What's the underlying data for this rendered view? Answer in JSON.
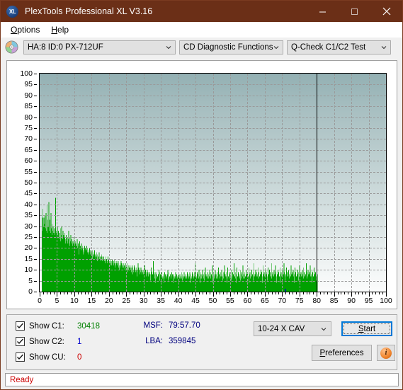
{
  "window": {
    "title": "PlexTools Professional XL V3.16",
    "icon": "xl-logo-icon",
    "minimize": "—",
    "maximize": "☐",
    "close": "✕"
  },
  "menubar": {
    "items": [
      {
        "label": "Options",
        "accel": "O"
      },
      {
        "label": "Help",
        "accel": "H"
      }
    ]
  },
  "toolbar": {
    "disc_icon": "cd-disc-icon",
    "drive_select": "HA:8 ID:0  PX-712UF",
    "function_select": "CD Diagnostic Functions",
    "test_select": "Q-Check C1/C2 Test"
  },
  "controls": {
    "checkboxes": [
      {
        "label": "Show C1:",
        "value": "30418",
        "checked": true,
        "color": "#008000"
      },
      {
        "label": "Show C2:",
        "value": "1",
        "checked": true,
        "color": "#0000cc"
      },
      {
        "label": "Show CU:",
        "value": "0",
        "checked": true,
        "color": "#cc0000"
      }
    ],
    "readouts": [
      {
        "key": "MSF:",
        "value": "79:57.70"
      },
      {
        "key": "LBA:",
        "value": "359845"
      }
    ],
    "speed_select": "10-24 X CAV",
    "start_button": "Start",
    "preferences_button": "Preferences",
    "info_button": "i"
  },
  "status": {
    "text": "Ready"
  },
  "chart_data": {
    "type": "bar",
    "title": "",
    "xlabel": "",
    "ylabel": "",
    "xlim": [
      0,
      100
    ],
    "ylim": [
      0,
      100
    ],
    "xticks": [
      0,
      5,
      10,
      15,
      20,
      25,
      30,
      35,
      40,
      45,
      50,
      55,
      60,
      65,
      70,
      75,
      80,
      85,
      90,
      95,
      100
    ],
    "yticks": [
      0,
      5,
      10,
      15,
      20,
      25,
      30,
      35,
      40,
      45,
      50,
      55,
      60,
      65,
      70,
      75,
      80,
      85,
      90,
      95,
      100
    ],
    "grid": true,
    "legend": false,
    "data_end_x": 80,
    "end_marker_x": 80,
    "series": [
      {
        "name": "C1",
        "color": "#00a000",
        "x_start": 0.6,
        "x_end": 80.2,
        "values": [
          28,
          34,
          31,
          38,
          30,
          26,
          34,
          27,
          31,
          35,
          24,
          29,
          36,
          28,
          25,
          40,
          27,
          33,
          26,
          30,
          29,
          41,
          28,
          25,
          33,
          27,
          24,
          36,
          29,
          22,
          31,
          26,
          28,
          23,
          30,
          25,
          27,
          21,
          29,
          24,
          26,
          43,
          28,
          22,
          27,
          25,
          23,
          30,
          26,
          21,
          28,
          24,
          22,
          27,
          25,
          20,
          29,
          23,
          26,
          22,
          30,
          25,
          24,
          21,
          28,
          23,
          26,
          22,
          25,
          20,
          27,
          24,
          22,
          19,
          26,
          23,
          21,
          25,
          22,
          20,
          24,
          28,
          22,
          19,
          25,
          21,
          23,
          20,
          26,
          22,
          19,
          24,
          21,
          18,
          23,
          20,
          22,
          19,
          25,
          21,
          18,
          23,
          20,
          22,
          19,
          21,
          17,
          24,
          20,
          18,
          22,
          19,
          21,
          17,
          20,
          23,
          18,
          21,
          19,
          17,
          22,
          18,
          20,
          16,
          21,
          19,
          17,
          20,
          18,
          16,
          21,
          18,
          20,
          17,
          19,
          15,
          21,
          18,
          16,
          20,
          17,
          19,
          15,
          18,
          16,
          20,
          17,
          15,
          19,
          16,
          18,
          14,
          17,
          19,
          15,
          18,
          16,
          14,
          17,
          15,
          19,
          16,
          14,
          17,
          15,
          13,
          18,
          16,
          14,
          17,
          15,
          13,
          16,
          14,
          18,
          15,
          13,
          16,
          14,
          12,
          15,
          17,
          13,
          16,
          14,
          12,
          15,
          13,
          16,
          14,
          12,
          15,
          13,
          11,
          16,
          14,
          12,
          15,
          13,
          11,
          14,
          16,
          12,
          15,
          13,
          11,
          14,
          12,
          15,
          13,
          11,
          14,
          12,
          10,
          15,
          13,
          11,
          14,
          12,
          10,
          13,
          15,
          11,
          14,
          12,
          10,
          13,
          11,
          14,
          12,
          10,
          13,
          11,
          9,
          14,
          12,
          10,
          13,
          11,
          9,
          12,
          14,
          10,
          13,
          11,
          9,
          12,
          10,
          13,
          11,
          9,
          12,
          10,
          8,
          13,
          11,
          9,
          12,
          10,
          8,
          11,
          13,
          9,
          12,
          10,
          8,
          11,
          9,
          12,
          10,
          8,
          11,
          9,
          7,
          12,
          10,
          8,
          11,
          9,
          7,
          10,
          12,
          8,
          11,
          9,
          7,
          10,
          8,
          11,
          9,
          7,
          10,
          8,
          13,
          9,
          11,
          7,
          10,
          8,
          6,
          9,
          11,
          7,
          10,
          8,
          6,
          9,
          7,
          10,
          8,
          6,
          9,
          7,
          12,
          8,
          10,
          6,
          9,
          7,
          5,
          8,
          10,
          6,
          9,
          7,
          5,
          8,
          6,
          9,
          7,
          5,
          8,
          6,
          11,
          7,
          9,
          5,
          8,
          6,
          14,
          7,
          9,
          5,
          8,
          6,
          4,
          7,
          9,
          5,
          8,
          6,
          4,
          7,
          5,
          8,
          6,
          10,
          7,
          5,
          9,
          6,
          8,
          4,
          7,
          5,
          9,
          6,
          4,
          7,
          5,
          8,
          6,
          4,
          7,
          9,
          5,
          8,
          6,
          4,
          7,
          5,
          8,
          6,
          10,
          7,
          5,
          9,
          6,
          4,
          7,
          5,
          8,
          6,
          4,
          7,
          9,
          5,
          8,
          6,
          4,
          7,
          5,
          8,
          6,
          4,
          7,
          5,
          9,
          6,
          4,
          8,
          5,
          7,
          6,
          4,
          8,
          5,
          7,
          6,
          4,
          8,
          6,
          5,
          7,
          4,
          9,
          6,
          5,
          8,
          4,
          7,
          6,
          5,
          9,
          4,
          7,
          6,
          5,
          8,
          4,
          7,
          6,
          5,
          9,
          4,
          8,
          6,
          5,
          7,
          4,
          9,
          6,
          5,
          8,
          4,
          7,
          6,
          5,
          9,
          4,
          8,
          6,
          5,
          7,
          4,
          9,
          6,
          13,
          8,
          5,
          7,
          6,
          4,
          9,
          5,
          8,
          6,
          4,
          10,
          5,
          7,
          6,
          4,
          9,
          5,
          8,
          6,
          4,
          7,
          10,
          5,
          8,
          6,
          4,
          9,
          5,
          7,
          6,
          11,
          4,
          8,
          5,
          7,
          6,
          4,
          9,
          5,
          8,
          6,
          10,
          4,
          7,
          5,
          9,
          6,
          4,
          8,
          5,
          7,
          12,
          6,
          4,
          9,
          5,
          8,
          6,
          4,
          7,
          10,
          5,
          8,
          6,
          4,
          9,
          5,
          7,
          6,
          4,
          11,
          5,
          8,
          6,
          4,
          9,
          5,
          7,
          6,
          10,
          4,
          8,
          5,
          7,
          6,
          4,
          9,
          5,
          12,
          6,
          8,
          4,
          7,
          5,
          9,
          6,
          4,
          8,
          11,
          5,
          7,
          6,
          4,
          9,
          5,
          8,
          6,
          4,
          10,
          5,
          7,
          6,
          4,
          9,
          5,
          8,
          6,
          13,
          4,
          7,
          5,
          9,
          6,
          4,
          8,
          5,
          11,
          6,
          7,
          4,
          9,
          5,
          8,
          6,
          4,
          7,
          10,
          5,
          8,
          6,
          4,
          9,
          5,
          7,
          12,
          6,
          4,
          8,
          5,
          9,
          6,
          4,
          7,
          5,
          10,
          6,
          8,
          4,
          9,
          5,
          7,
          6,
          11,
          4,
          8,
          5,
          9,
          6,
          4,
          7,
          5,
          10,
          6,
          8,
          4,
          9,
          5,
          13,
          6,
          7,
          4,
          8,
          5,
          10,
          6,
          9,
          4,
          7,
          5,
          8,
          6,
          11,
          4,
          9,
          5,
          7,
          6,
          8,
          4,
          10,
          5,
          9,
          6,
          7,
          4,
          12,
          5,
          8,
          6,
          9,
          4,
          7,
          5,
          10,
          6,
          8,
          4,
          9,
          5,
          7,
          6,
          11,
          4,
          8,
          5,
          10,
          6,
          9,
          4,
          7,
          5,
          13,
          6,
          8,
          4,
          9,
          5,
          7,
          6,
          10,
          4,
          8,
          5,
          12,
          6,
          9,
          4,
          7,
          5,
          8,
          6,
          10,
          4,
          9,
          5,
          7,
          6,
          11,
          4,
          8,
          5,
          9,
          6,
          7,
          4,
          10,
          5,
          8,
          6,
          13,
          4,
          9,
          5,
          7,
          6,
          8,
          4,
          11,
          5,
          9,
          6,
          7,
          4,
          10,
          5,
          8,
          6,
          9,
          4,
          7,
          5,
          12,
          6,
          8,
          4,
          9,
          5,
          10,
          6,
          7,
          4,
          8,
          5,
          11,
          6,
          9,
          4,
          7,
          5,
          8,
          6,
          10,
          4,
          9,
          5,
          7,
          6,
          12,
          4,
          8,
          5,
          9,
          6,
          7,
          4,
          10,
          5,
          8,
          6,
          11,
          4,
          9,
          5,
          7,
          6,
          8,
          4,
          13,
          5,
          9,
          6,
          7,
          4,
          10,
          5,
          8,
          6,
          9,
          4,
          12,
          5,
          7,
          6,
          8,
          4,
          10,
          5,
          9,
          6,
          7,
          4,
          11,
          5,
          8,
          6,
          9,
          4,
          7,
          5,
          10,
          6,
          8
        ]
      },
      {
        "name": "C2",
        "color": "#0000cc",
        "points": [
          {
            "x": 70.8,
            "y": 1
          }
        ]
      }
    ]
  }
}
